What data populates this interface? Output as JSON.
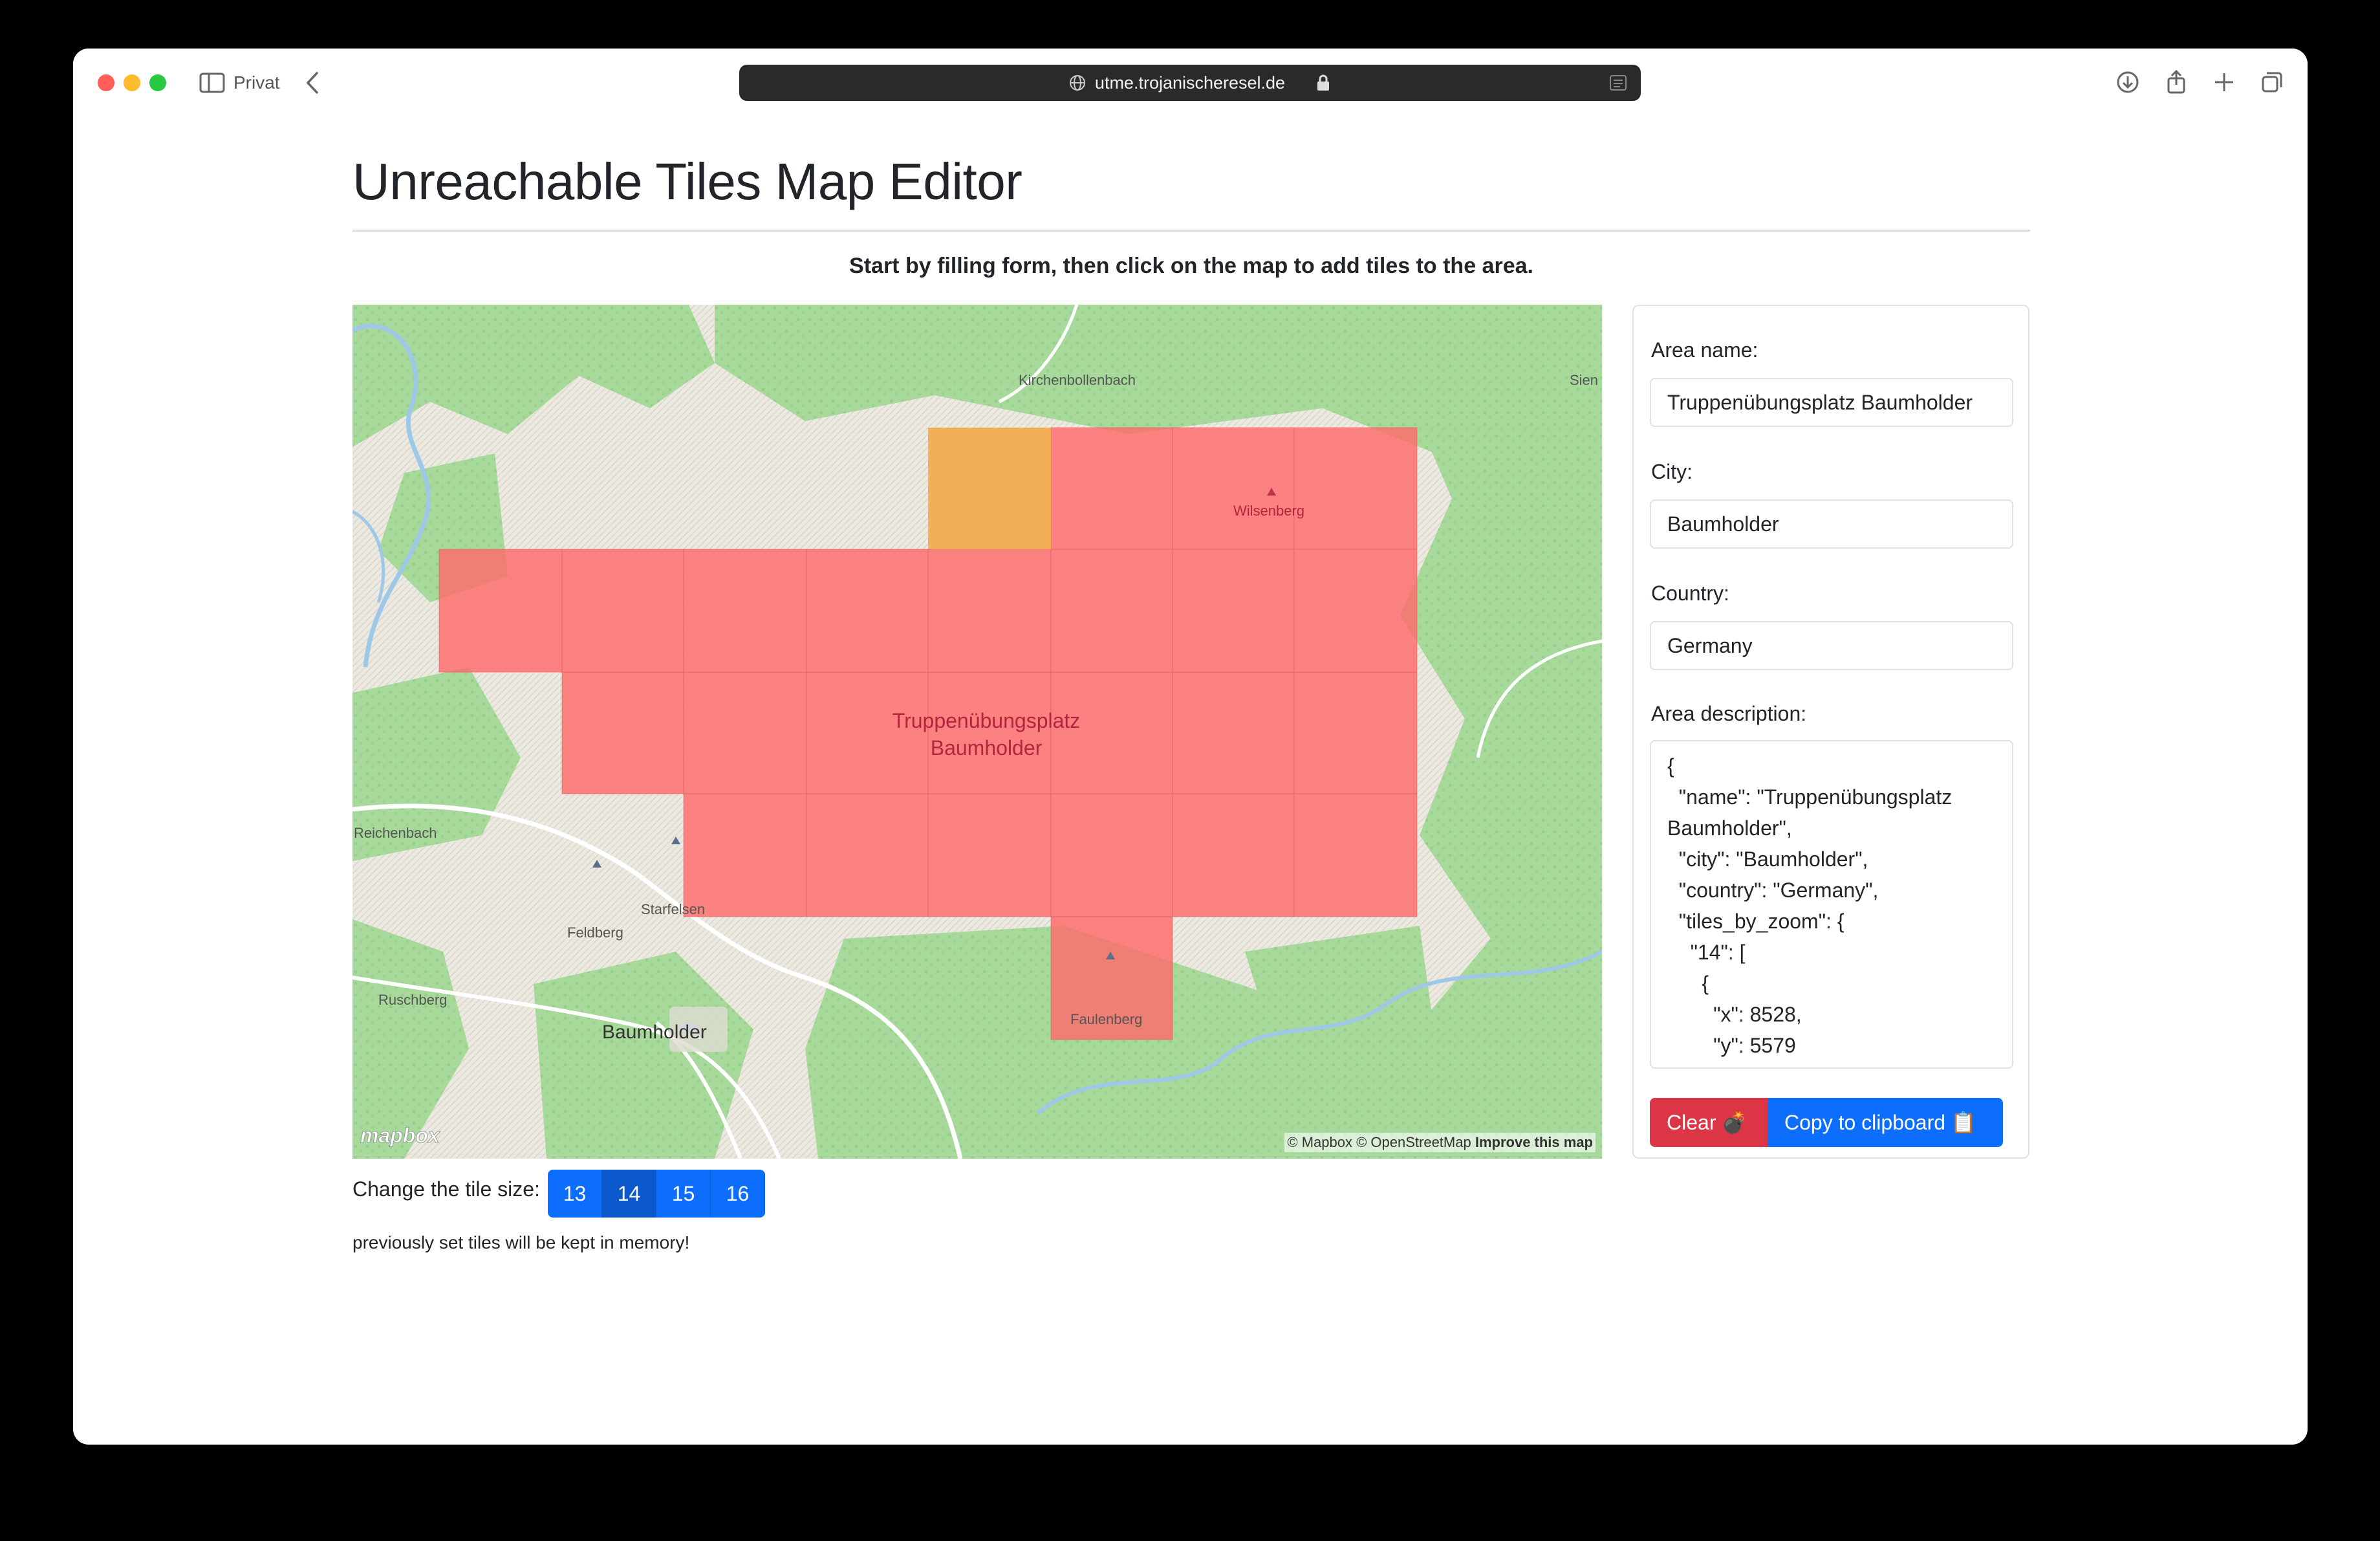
{
  "browser": {
    "profile_label": "Privat",
    "url": "utme.trojanischeresel.de"
  },
  "page": {
    "title": "Unreachable Tiles Map Editor",
    "instruction": "Start by filling form, then click on the map to add tiles to the area."
  },
  "map": {
    "area_label": "Truppenübungsplatz\nBaumholder",
    "places": {
      "kirchenbollenbach": "Kirchenbollenbach",
      "sien": "Sien",
      "wilsenberg": "Wilsenberg",
      "reichenbach": "Reichenbach",
      "starfelsen": "Starfelsen",
      "feldberg": "Feldberg",
      "ruschberg": "Ruschberg",
      "baumholder": "Baumholder",
      "faulenberg": "Faulenberg"
    },
    "logo": "mapbox",
    "attribution": "© Mapbox © OpenStreetMap",
    "improve_link": "Improve this map",
    "colors": {
      "tile_selected": "#ff6b6b",
      "tile_highlight": "#f4a340"
    }
  },
  "tile_size": {
    "label": "Change the tile size:",
    "options": [
      "13",
      "14",
      "15",
      "16"
    ],
    "selected": "14",
    "note": "previously set tiles will be kept in memory!"
  },
  "form": {
    "name_label": "Area name:",
    "name_value": "Truppenübungsplatz Baumholder",
    "city_label": "City:",
    "city_value": "Baumholder",
    "country_label": "Country:",
    "country_value": "Germany",
    "description_label": "Area description:",
    "description_value": "{\n  \"name\": \"Truppenübungsplatz Baumholder\",\n  \"city\": \"Baumholder\",\n  \"country\": \"Germany\",\n  \"tiles_by_zoom\": {\n    \"14\": [\n      {\n        \"x\": 8528,\n        \"y\": 5579",
    "clear_label": "Clear",
    "clear_icon": "💣",
    "copy_label": "Copy to clipboard",
    "copy_icon": "📋"
  }
}
